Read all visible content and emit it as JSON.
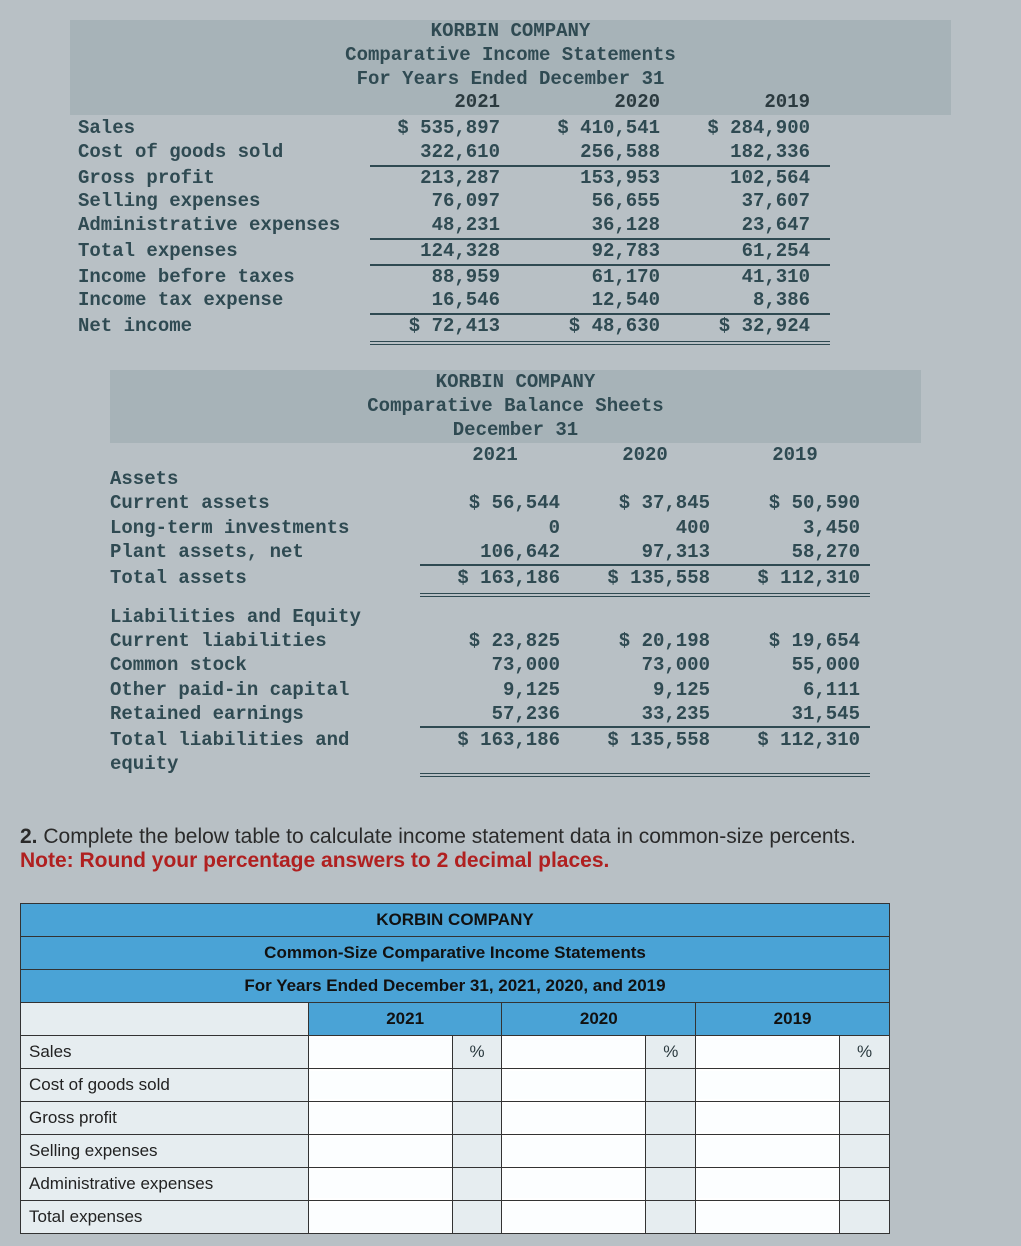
{
  "income_statement": {
    "company": "KORBIN COMPANY",
    "title": "Comparative Income Statements",
    "period": "For Years Ended December 31",
    "years": [
      "2021",
      "2020",
      "2019"
    ],
    "rows": [
      {
        "label": "Sales",
        "v": [
          "$ 535,897",
          "$ 410,541",
          "$ 284,900"
        ],
        "rule": "none"
      },
      {
        "label": "Cost of goods sold",
        "v": [
          "322,610",
          "256,588",
          "182,336"
        ],
        "rule": "thin"
      },
      {
        "label": "Gross profit",
        "v": [
          "213,287",
          "153,953",
          "102,564"
        ],
        "rule": "none"
      },
      {
        "label": "Selling expenses",
        "v": [
          "76,097",
          "56,655",
          "37,607"
        ],
        "rule": "none"
      },
      {
        "label": "Administrative expenses",
        "v": [
          "48,231",
          "36,128",
          "23,647"
        ],
        "rule": "thin"
      },
      {
        "label": "Total expenses",
        "v": [
          "124,328",
          "92,783",
          "61,254"
        ],
        "rule": "thin"
      },
      {
        "label": "Income before taxes",
        "v": [
          "88,959",
          "61,170",
          "41,310"
        ],
        "rule": "none"
      },
      {
        "label": "Income tax expense",
        "v": [
          "16,546",
          "12,540",
          "8,386"
        ],
        "rule": "thin"
      },
      {
        "label": "Net income",
        "v": [
          "$ 72,413",
          "$ 48,630",
          "$ 32,924"
        ],
        "rule": "dbl"
      }
    ]
  },
  "balance_sheet": {
    "company": "KORBIN COMPANY",
    "title": "Comparative Balance Sheets",
    "period": "December 31",
    "years": [
      "2021",
      "2020",
      "2019"
    ],
    "sections": [
      {
        "heading": "Assets",
        "rows": [
          {
            "label": "Current assets",
            "v": [
              "$ 56,544",
              "$ 37,845",
              "$ 50,590"
            ],
            "rule": "none"
          },
          {
            "label": "Long-term investments",
            "v": [
              "0",
              "400",
              "3,450"
            ],
            "rule": "none"
          },
          {
            "label": "Plant assets, net",
            "v": [
              "106,642",
              "97,313",
              "58,270"
            ],
            "rule": "thin"
          },
          {
            "label": "Total assets",
            "v": [
              "$ 163,186",
              "$ 135,558",
              "$ 112,310"
            ],
            "rule": "dbl"
          }
        ]
      },
      {
        "heading": "Liabilities and Equity",
        "rows": [
          {
            "label": "Current liabilities",
            "v": [
              "$ 23,825",
              "$ 20,198",
              "$ 19,654"
            ],
            "rule": "none"
          },
          {
            "label": "Common stock",
            "v": [
              "73,000",
              "73,000",
              "55,000"
            ],
            "rule": "none"
          },
          {
            "label": "Other paid-in capital",
            "v": [
              "9,125",
              "9,125",
              "6,111"
            ],
            "rule": "none"
          },
          {
            "label": "Retained earnings",
            "v": [
              "57,236",
              "33,235",
              "31,545"
            ],
            "rule": "thin"
          },
          {
            "label": "Total liabilities and equity",
            "v": [
              "$ 163,186",
              "$ 135,558",
              "$ 112,310"
            ],
            "rule": "dbl"
          }
        ]
      }
    ]
  },
  "question": {
    "num": "2.",
    "text": "Complete the below table to calculate income statement data in common-size percents.",
    "note": "Note: Round your percentage answers to 2 decimal places."
  },
  "answer_table": {
    "company": "KORBIN COMPANY",
    "title": "Common-Size Comparative Income Statements",
    "period": "For Years Ended December 31, 2021, 2020, and 2019",
    "years": [
      "2021",
      "2020",
      "2019"
    ],
    "pct": "%",
    "rows": [
      "Sales",
      "Cost of goods sold",
      "Gross profit",
      "Selling expenses",
      "Administrative expenses",
      "Total expenses"
    ]
  },
  "chart_data": {
    "type": "table",
    "title": "KORBIN COMPANY — Comparative Income Statements & Balance Sheets",
    "income_statement": {
      "years": [
        2021,
        2020,
        2019
      ],
      "line_items": {
        "Sales": [
          535897,
          410541,
          284900
        ],
        "Cost of goods sold": [
          322610,
          256588,
          182336
        ],
        "Gross profit": [
          213287,
          153953,
          102564
        ],
        "Selling expenses": [
          76097,
          56655,
          37607
        ],
        "Administrative expenses": [
          48231,
          36128,
          23647
        ],
        "Total expenses": [
          124328,
          92783,
          61254
        ],
        "Income before taxes": [
          88959,
          61170,
          41310
        ],
        "Income tax expense": [
          16546,
          12540,
          8386
        ],
        "Net income": [
          72413,
          48630,
          32924
        ]
      }
    },
    "balance_sheet": {
      "years": [
        2021,
        2020,
        2019
      ],
      "assets": {
        "Current assets": [
          56544,
          37845,
          50590
        ],
        "Long-term investments": [
          0,
          400,
          3450
        ],
        "Plant assets, net": [
          106642,
          97313,
          58270
        ],
        "Total assets": [
          163186,
          135558,
          112310
        ]
      },
      "liabilities_and_equity": {
        "Current liabilities": [
          23825,
          20198,
          19654
        ],
        "Common stock": [
          73000,
          73000,
          55000
        ],
        "Other paid-in capital": [
          9125,
          9125,
          6111
        ],
        "Retained earnings": [
          57236,
          33235,
          31545
        ],
        "Total liabilities and equity": [
          163186,
          135558,
          112310
        ]
      }
    }
  }
}
